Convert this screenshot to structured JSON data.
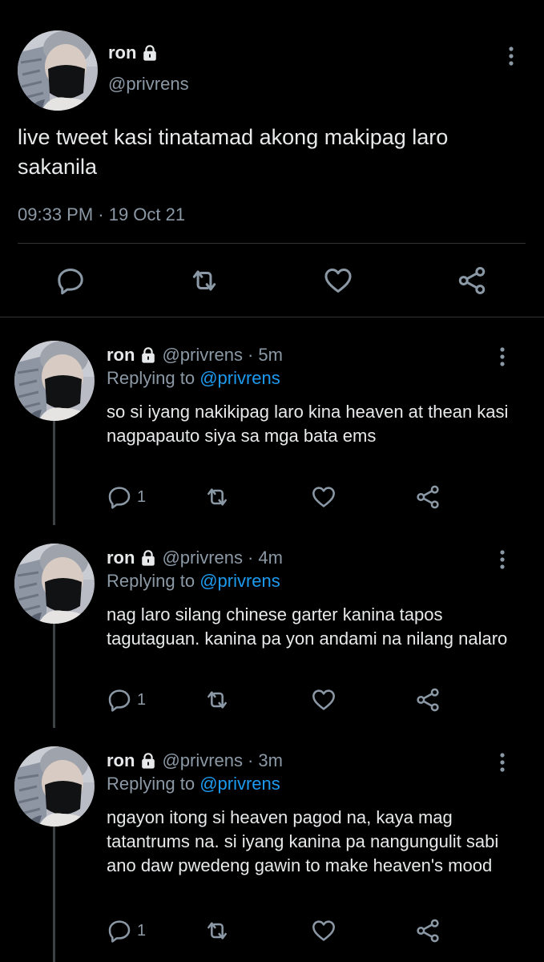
{
  "main_tweet": {
    "name": "ron",
    "handle": "@privrens",
    "text": "live tweet kasi tinatamad akong makipag laro sakanila",
    "time": "09:33 PM · 19 Oct 21"
  },
  "replies": [
    {
      "name": "ron",
      "handle": "@privrens",
      "separator": "·",
      "time": "5m",
      "replying_prefix": "Replying to ",
      "replying_to": "@privrens",
      "text": "so si iyang nakikipag laro kina heaven at thean kasi nagpapauto siya sa mga bata ems",
      "reply_count": "1"
    },
    {
      "name": "ron",
      "handle": "@privrens",
      "separator": "·",
      "time": "4m",
      "replying_prefix": "Replying to ",
      "replying_to": "@privrens",
      "text": "nag laro silang chinese garter kanina tapos tagutaguan. kanina pa yon andami na nilang nalaro",
      "reply_count": "1"
    },
    {
      "name": "ron",
      "handle": "@privrens",
      "separator": "·",
      "time": "3m",
      "replying_prefix": "Replying to ",
      "replying_to": "@privrens",
      "text": "ngayon itong si heaven pagod na, kaya mag tatantrums na. si iyang kanina pa nangungulit sabi ano daw pwedeng gawin to make heaven's mood",
      "reply_count": "1"
    }
  ],
  "icons": {
    "lock": "lock-icon",
    "more": "more-vertical-icon",
    "reply": "reply-icon",
    "retweet": "retweet-icon",
    "like": "heart-icon",
    "share": "share-icon"
  },
  "colors": {
    "background": "#000000",
    "text": "#e7e9ea",
    "muted": "#8b98a5",
    "link": "#1d9bf0",
    "divider": "#2f3336"
  }
}
